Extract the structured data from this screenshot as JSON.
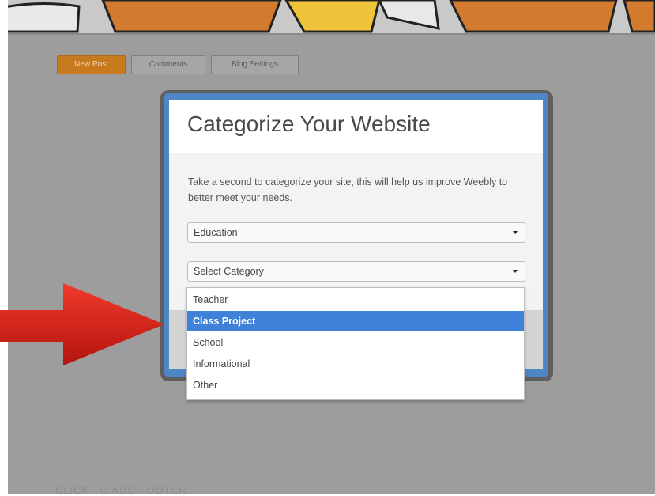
{
  "toolbar": {
    "new_post": "New Post",
    "comments": "Comments",
    "blog_settings": "Blog Settings"
  },
  "modal": {
    "title": "Categorize Your Website",
    "description": "Take a second to categorize your site, this will help us improve Weebly to better meet your needs.",
    "primary_select_value": "Education",
    "category_select_value": "Select Category",
    "options": [
      "Teacher",
      "Class Project",
      "School",
      "Informational",
      "Other"
    ],
    "highlighted_option": "Class Project"
  },
  "footer": {
    "text": "CLICK TO ADD FOOTER"
  },
  "colors": {
    "accent_orange": "#c77a1e",
    "modal_blue": "#4f86c6",
    "selection_blue": "#3f80d8",
    "arrow_red": "#d8261e"
  },
  "icons": [
    "chevron-down-icon",
    "red-arrow-pointer"
  ]
}
